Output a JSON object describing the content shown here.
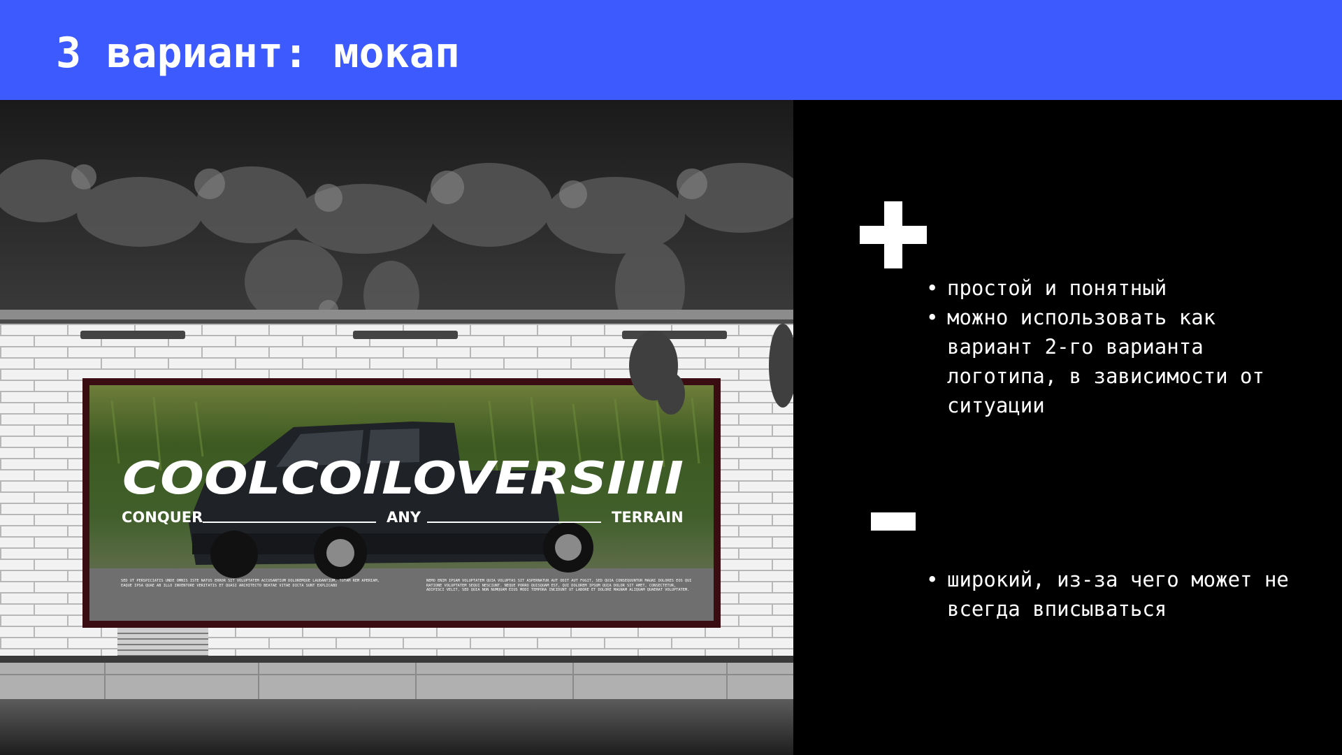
{
  "slide": {
    "title": "3 вариант: мокап",
    "accent_color": "#3d5afe"
  },
  "mockup": {
    "brand": "COOLCOILOVERSIIII",
    "tagline": [
      "CONQUER",
      "ANY",
      "TERRAIN"
    ],
    "body_left": "SED UT PERSPICIATIS UNDE OMNIS ISTE NATUS ERROR SIT VOLUPTATEM ACCUSANTIUM DOLOREMQUE LAUDANTIUM, TOTAM REM APERIAM, EAQUE IPSA QUAE AB ILLO INVENTORE VERITATIS ET QUASI ARCHITECTO BEATAE VITAE DICTA SUNT EXPLICABO",
    "body_right": "NEMO ENIM IPSAM VOLUPTATEM QUIA VOLUPTAS SIT ASPERNATUR AUT ODIT AUT FUGIT, SED QUIA CONSEQUUNTUR MAGNI DOLORES EOS QUI RATIONE VOLUPTATEM SEQUI NESCIUNT. NEQUE PORRO QUISQUAM EST, QUI DOLOREM IPSUM QUIA DOLOR SIT AMET, CONSECTETUR, ADIPISCI VELIT, SED QUIA NON NUMQUAM EIUS MODI TEMPORA INCIDUNT UT LABORE ET DOLORE MAGNAM ALIQUAM QUAERAT VOLUPTATEM."
  },
  "pros": {
    "icon": "plus-icon",
    "items": [
      "простой и понятный",
      "можно использовать как вариант 2-го варианта логотипа, в зависимости от ситуации"
    ]
  },
  "cons": {
    "icon": "minus-icon",
    "items": [
      "широкий, из-за чего может не всегда вписываться"
    ]
  }
}
